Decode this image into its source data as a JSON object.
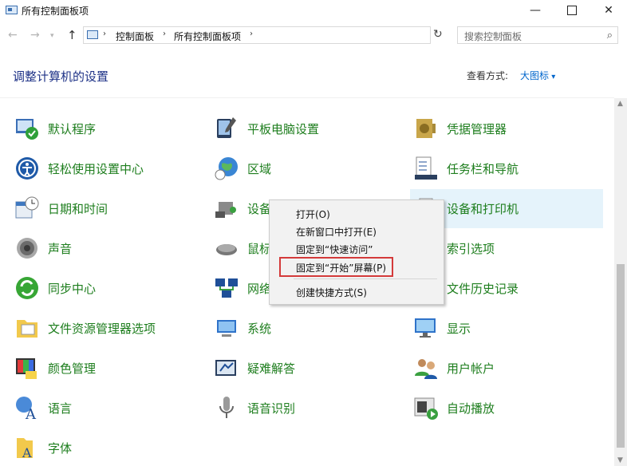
{
  "window": {
    "title": "所有控制面板项",
    "minimize": "—",
    "close": "✕"
  },
  "nav": {
    "back": "←",
    "forward": "→",
    "recent": "▾",
    "up": "↑",
    "refresh": "↻",
    "dropdown": "⌵"
  },
  "address": {
    "separator": "›",
    "crumbs": [
      "控制面板",
      "所有控制面板项"
    ]
  },
  "search": {
    "placeholder": "搜索控制面板",
    "icon": "⌕"
  },
  "header": {
    "title": "调整计算机的设置",
    "view_by_label": "查看方式:",
    "view_by_value": "大图标"
  },
  "items": [
    {
      "label": "默认程序",
      "icon": "default-programs-icon"
    },
    {
      "label": "平板电脑设置",
      "icon": "tablet-pc-settings-icon"
    },
    {
      "label": "凭据管理器",
      "icon": "credential-manager-icon"
    },
    {
      "label": "轻松使用设置中心",
      "icon": "ease-of-access-icon"
    },
    {
      "label": "区域",
      "icon": "region-icon"
    },
    {
      "label": "任务栏和导航",
      "icon": "taskbar-navigation-icon"
    },
    {
      "label": "日期和时间",
      "icon": "date-time-icon"
    },
    {
      "label": "设备",
      "icon": "device-manager-icon"
    },
    {
      "label": "设备和打印机",
      "icon": "devices-printers-icon"
    },
    {
      "label": "声音",
      "icon": "sound-icon"
    },
    {
      "label": "鼠标",
      "icon": "mouse-icon"
    },
    {
      "label": "索引选项",
      "icon": "indexing-options-icon"
    },
    {
      "label": "同步中心",
      "icon": "sync-center-icon"
    },
    {
      "label": "网络",
      "icon": "network-icon"
    },
    {
      "label": "文件历史记录",
      "icon": "file-history-icon"
    },
    {
      "label": "文件资源管理器选项",
      "icon": "file-explorer-options-icon"
    },
    {
      "label": "系统",
      "icon": "system-icon"
    },
    {
      "label": "显示",
      "icon": "display-icon"
    },
    {
      "label": "颜色管理",
      "icon": "color-management-icon"
    },
    {
      "label": "疑难解答",
      "icon": "troubleshooting-icon"
    },
    {
      "label": "用户帐户",
      "icon": "user-accounts-icon"
    },
    {
      "label": "语言",
      "icon": "language-icon"
    },
    {
      "label": "语音识别",
      "icon": "speech-recognition-icon"
    },
    {
      "label": "自动播放",
      "icon": "autoplay-icon"
    },
    {
      "label": "字体",
      "icon": "fonts-icon"
    }
  ],
  "context_menu": {
    "open": "打开(O)",
    "open_new_window": "在新窗口中打开(E)",
    "pin_quick_access": "固定到“快速访问”",
    "pin_start": "固定到“开始”屏幕(P)",
    "create_shortcut": "创建快捷方式(S)"
  },
  "scrollbar": {
    "up": "▲",
    "down": "▼"
  },
  "colors": {
    "link_green": "#1e7e1e",
    "heading_blue": "#1e3287",
    "highlight": "#e5f3fb",
    "annotation_red": "#d43a3a"
  }
}
